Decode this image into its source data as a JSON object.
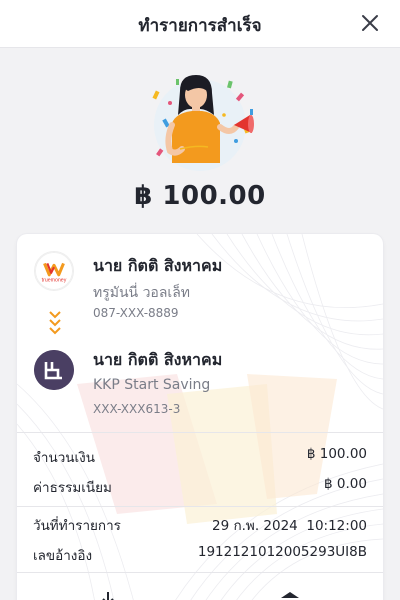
{
  "header": {
    "title": "ทำรายการสำเร็จ",
    "close_icon": "close-icon"
  },
  "summary": {
    "amount": "฿ 100.00",
    "illustration": "celebration-illustration"
  },
  "sender": {
    "name": "นาย กิตติ สิงหาคม",
    "wallet": "ทรูมันนี่ วอลเล็ท",
    "phone": "087-XXX-8889",
    "logo_text": "truemoney",
    "logo_icon": "truemoney-logo"
  },
  "receiver": {
    "name": "นาย กิตติ สิงหาคม",
    "bank": "KKP Start Saving",
    "account": "XXX-XXX613-3",
    "logo_icon": "kkp-logo"
  },
  "details": {
    "amount_label": "จำนวนเงิน",
    "amount_value": "฿ 100.00",
    "fee_label": "ค่าธรรมเนียม",
    "fee_value": "฿ 0.00",
    "date_label": "วันที่ทำรายการ",
    "date_value": "29 ก.พ. 2024",
    "time_value": "10:12:00",
    "ref_label": "เลขอ้างอิง",
    "ref_value": "191212101200529​3UI8B"
  },
  "actions": {
    "left_icon": "download-icon",
    "right_icon": "bank-icon"
  },
  "colors": {
    "accent_orange": "#f39a1e",
    "kkp_purple": "#4a3f63",
    "truemoney_red": "#e3342f"
  }
}
